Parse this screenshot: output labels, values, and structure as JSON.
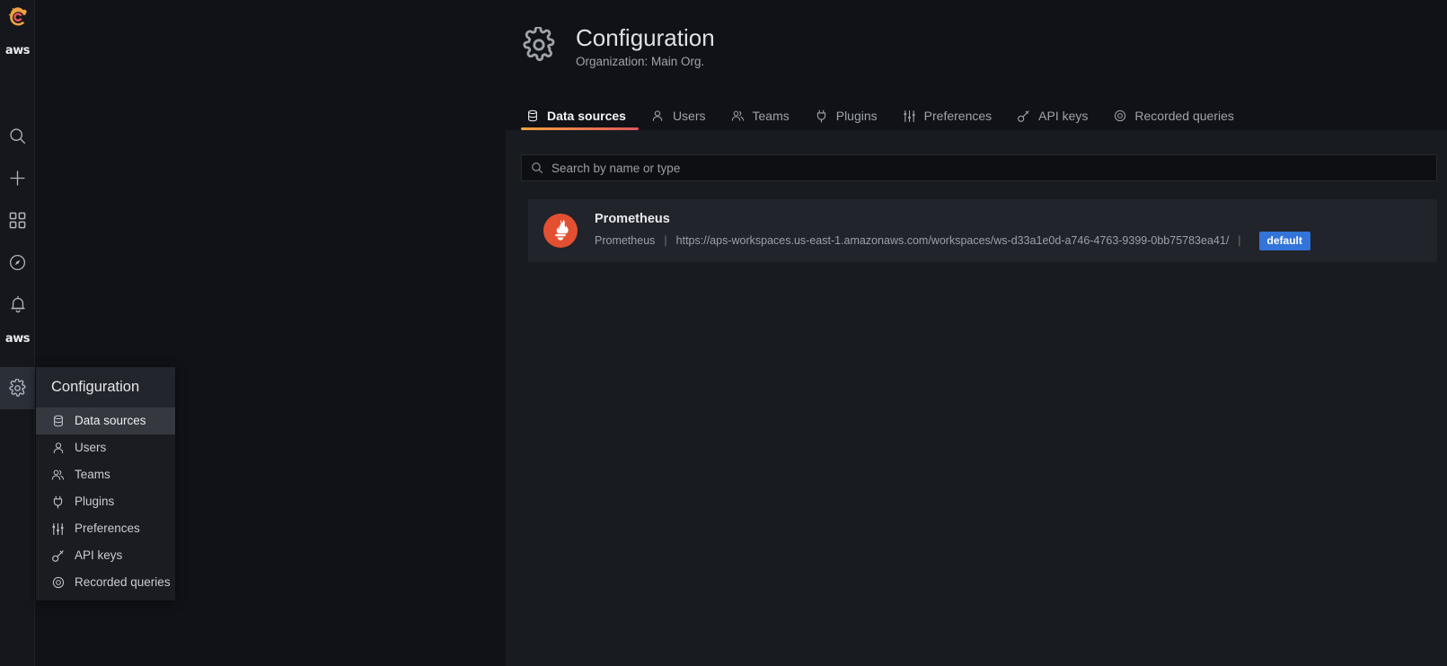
{
  "nav_rail": {
    "brand_logo": "grafana-logo-icon",
    "aws_top_label": "aws",
    "aws_bottom_label": "aws",
    "items": [
      {
        "name": "search",
        "icon": "search-icon",
        "active": false
      },
      {
        "name": "create",
        "icon": "plus-icon",
        "active": false
      },
      {
        "name": "dashboards",
        "icon": "apps-grid-icon",
        "active": false
      },
      {
        "name": "explore",
        "icon": "compass-icon",
        "active": false
      },
      {
        "name": "alerting",
        "icon": "bell-icon",
        "active": false
      },
      {
        "name": "configuration",
        "icon": "gear-icon",
        "active": true
      }
    ]
  },
  "flyout": {
    "title": "Configuration",
    "items": [
      {
        "label": "Data sources",
        "icon": "database-icon",
        "selected": true
      },
      {
        "label": "Users",
        "icon": "user-icon",
        "selected": false
      },
      {
        "label": "Teams",
        "icon": "users-icon",
        "selected": false
      },
      {
        "label": "Plugins",
        "icon": "plug-icon",
        "selected": false
      },
      {
        "label": "Preferences",
        "icon": "sliders-icon",
        "selected": false
      },
      {
        "label": "API keys",
        "icon": "key-icon",
        "selected": false
      },
      {
        "label": "Recorded queries",
        "icon": "record-dot-icon",
        "selected": false
      }
    ]
  },
  "page": {
    "icon": "gear-icon",
    "title": "Configuration",
    "subtitle": "Organization: Main Org."
  },
  "tabs": [
    {
      "label": "Data sources",
      "icon": "database-icon",
      "active": true
    },
    {
      "label": "Users",
      "icon": "user-icon",
      "active": false
    },
    {
      "label": "Teams",
      "icon": "users-icon",
      "active": false
    },
    {
      "label": "Plugins",
      "icon": "plug-icon",
      "active": false
    },
    {
      "label": "Preferences",
      "icon": "sliders-icon",
      "active": false
    },
    {
      "label": "API keys",
      "icon": "key-icon",
      "active": false
    },
    {
      "label": "Recorded queries",
      "icon": "record-dot-icon",
      "active": false
    }
  ],
  "search": {
    "icon": "search-icon",
    "placeholder": "Search by name or type",
    "value": ""
  },
  "data_sources": [
    {
      "name": "Prometheus",
      "logo": "prometheus-logo-icon",
      "type": "Prometheus",
      "separator": "|",
      "url": "https://aps-workspaces.us-east-1.amazonaws.com/workspaces/ws-d33a1e0d-a746-4763-9399-0bb75783ea41/",
      "badge": "default"
    }
  ],
  "colors": {
    "accent_orange": "#f2a241",
    "accent_red": "#e0565b",
    "badge_blue": "#3274d9",
    "prometheus_orange": "#e35031",
    "panel_bg": "#181b1f",
    "header_bg": "#111217",
    "rail_bg": "#15171c",
    "card_bg": "#21242a"
  }
}
